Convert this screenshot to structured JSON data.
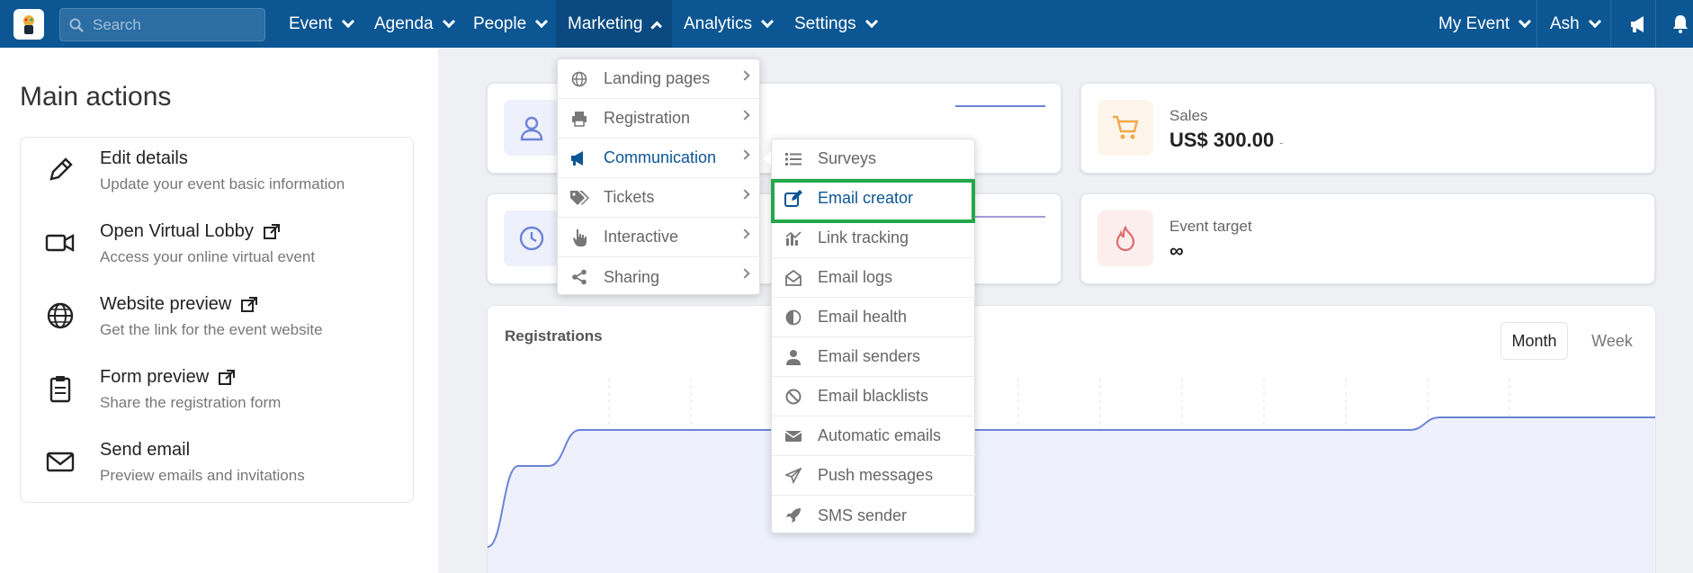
{
  "colors": {
    "brand": "#0c5693",
    "accent_green": "#22a84a",
    "line": "#6b84d6"
  },
  "topbar": {
    "search_placeholder": "Search",
    "nav": [
      "Event",
      "Agenda",
      "People",
      "Marketing",
      "Analytics",
      "Settings"
    ],
    "right": [
      "My Event",
      "Ash"
    ],
    "icons": [
      "megaphone-icon",
      "bell-icon"
    ]
  },
  "left": {
    "title": "Main actions",
    "actions": [
      {
        "title": "Edit details",
        "desc": "Update your event basic information",
        "icon": "pencil-icon",
        "external": false
      },
      {
        "title": "Open Virtual Lobby",
        "desc": "Access your online virtual event",
        "icon": "video-camera-icon",
        "external": true
      },
      {
        "title": "Website preview",
        "desc": "Get the link for the event website",
        "icon": "globe-icon",
        "external": true
      },
      {
        "title": "Form preview",
        "desc": "Share the registration form",
        "icon": "clipboard-icon",
        "external": true
      },
      {
        "title": "Send email",
        "desc": "Preview emails and invitations",
        "icon": "envelope-icon",
        "external": false
      }
    ]
  },
  "stats": {
    "sales_label": "Sales",
    "sales_value": "US$ 300.00",
    "sales_suffix": "-",
    "target_label": "Event target",
    "target_value": "∞"
  },
  "chart": {
    "title": "Registrations",
    "toggle": [
      "Month",
      "Week"
    ],
    "selected": "Month"
  },
  "chart_data": {
    "type": "area",
    "title": "Registrations",
    "series": [
      {
        "values": [
          0.1,
          0.55,
          0.55,
          0.75,
          0.75,
          0.75,
          0.75,
          0.75,
          0.75,
          0.75,
          0.75,
          0.75,
          0.75,
          0.75,
          0.75,
          0.75,
          0.75,
          0.75,
          0.75,
          0.75,
          0.75,
          0.75,
          0.75,
          0.75,
          0.75,
          0.75,
          0.75,
          0.75,
          0.75,
          0.75,
          0.75,
          0.82,
          0.82,
          0.82,
          0.82,
          0.82,
          0.82,
          0.82,
          0.82
        ]
      }
    ]
  },
  "marketing_menu": [
    {
      "label": "Landing pages",
      "icon": "globe-icon"
    },
    {
      "label": "Registration",
      "icon": "printer-icon"
    },
    {
      "label": "Communication",
      "icon": "megaphone-icon",
      "active": true
    },
    {
      "label": "Tickets",
      "icon": "tags-icon"
    },
    {
      "label": "Interactive",
      "icon": "pointer-hand-icon"
    },
    {
      "label": "Sharing",
      "icon": "share-icon"
    }
  ],
  "communication_menu": [
    {
      "label": "Surveys",
      "icon": "list-icon"
    },
    {
      "label": "Email creator",
      "icon": "edit-square-icon",
      "active": true
    },
    {
      "label": "Link tracking",
      "icon": "chart-bars-icon"
    },
    {
      "label": "Email logs",
      "icon": "envelope-open-icon"
    },
    {
      "label": "Email health",
      "icon": "half-circle-icon"
    },
    {
      "label": "Email senders",
      "icon": "user-icon"
    },
    {
      "label": "Email blacklists",
      "icon": "ban-icon"
    },
    {
      "label": "Automatic emails",
      "icon": "envelope-icon"
    },
    {
      "label": "Push messages",
      "icon": "paper-plane-icon"
    },
    {
      "label": "SMS sender",
      "icon": "rocket-icon"
    }
  ]
}
